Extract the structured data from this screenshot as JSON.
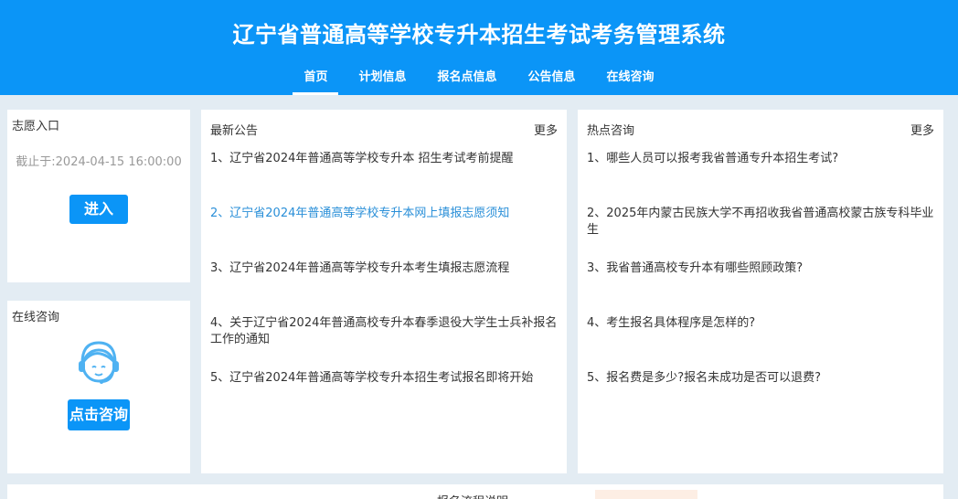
{
  "header": {
    "title": "辽宁省普通高等学校专升本招生考试考务管理系统",
    "nav": [
      "首页",
      "计划信息",
      "报名点信息",
      "公告信息",
      "在线咨询"
    ],
    "active_index": 0
  },
  "volunteer": {
    "title": "志愿入口",
    "deadline": "截止于:2024-04-15 16:00:00",
    "enter_label": "进入"
  },
  "consult": {
    "title": "在线咨询",
    "button_label": "点击咨询",
    "avatar_icon": "customer-service-icon"
  },
  "news": {
    "title": "最新公告",
    "more": "更多",
    "items": [
      "1、辽宁省2024年普通高等学校专升本 招生考试考前提醒",
      "2、辽宁省2024年普通高等学校专升本网上填报志愿须知",
      "3、辽宁省2024年普通高等学校专升本考生填报志愿流程",
      "4、关于辽宁省2024年普通高校专升本春季退役大学生士兵补报名工作的通知",
      "5、辽宁省2024年普通高等学校专升本招生考试报名即将开始"
    ],
    "highlight_index": 1
  },
  "hot": {
    "title": "热点咨询",
    "more": "更多",
    "items": [
      "1、哪些人员可以报考我省普通专升本招生考试?",
      "2、2025年内蒙古民族大学不再招收我省普通高校蒙古族专科毕业生",
      "3、我省普通高校专升本有哪些照顾政策?",
      "4、考生报名具体程序是怎样的?",
      "5、报名费是多少?报名未成功是否可以退费?"
    ]
  },
  "bottom": {
    "text": "报名流程说明"
  },
  "colors": {
    "primary": "#0b95f7",
    "highlight": "#2a8fd8",
    "background": "#e3ecf3"
  }
}
